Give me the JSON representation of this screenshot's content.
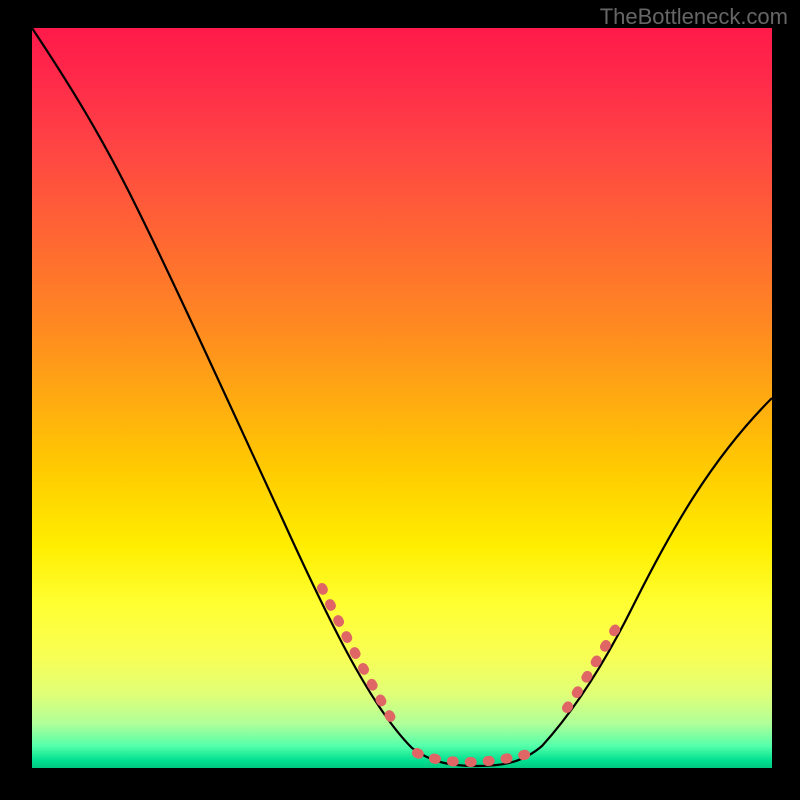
{
  "watermark": "TheBottleneck.com",
  "chart_data": {
    "type": "line",
    "title": "",
    "xlabel": "",
    "ylabel": "",
    "xlim": [
      0,
      100
    ],
    "ylim": [
      0,
      100
    ],
    "series": [
      {
        "name": "bottleneck-curve",
        "x": [
          0,
          5,
          10,
          15,
          20,
          25,
          30,
          35,
          40,
          45,
          50,
          53,
          56,
          59,
          62,
          65,
          68,
          72,
          76,
          80,
          84,
          88,
          92,
          96,
          100
        ],
        "y": [
          100,
          94,
          87,
          80,
          72,
          63,
          54,
          44,
          33,
          21,
          11,
          6,
          2,
          0,
          0,
          0,
          2,
          6,
          12,
          19,
          26,
          33,
          39,
          45,
          50
        ]
      }
    ],
    "highlight_segments": [
      {
        "name": "left-dots",
        "x_range": [
          39,
          50
        ],
        "style": "dashed-pink"
      },
      {
        "name": "bottom-dots",
        "x_range": [
          53,
          68
        ],
        "style": "dashed-pink"
      },
      {
        "name": "right-dots",
        "x_range": [
          70,
          78
        ],
        "style": "dashed-pink"
      }
    ],
    "background_gradient": {
      "top": "#ff1a4a",
      "mid": "#ffee00",
      "bottom": "#00c880"
    }
  }
}
